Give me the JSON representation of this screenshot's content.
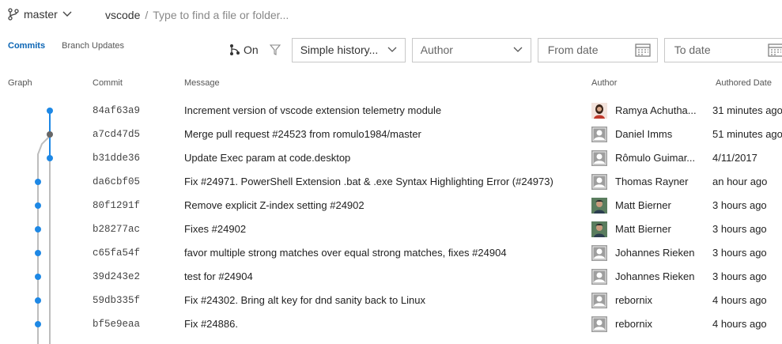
{
  "topbar": {
    "branch": "master",
    "repo": "vscode",
    "separator": "/",
    "search_placeholder": "Type to find a file or folder..."
  },
  "tabs": {
    "commits": "Commits",
    "branch_updates": "Branch Updates"
  },
  "filters": {
    "graph_toggle": "On",
    "history_mode": "Simple history...",
    "author": "Author",
    "from_date": "From date",
    "to_date": "To date"
  },
  "columns": {
    "graph": "Graph",
    "commit": "Commit",
    "message": "Message",
    "author": "Author",
    "authored_date": "Authored Date"
  },
  "commits": [
    {
      "sha": "84af63a9",
      "message": "Increment version of vscode extension telemetry module",
      "author": "Ramya Achutha...",
      "date": "31 minutes ago",
      "avatar": "photo-woman"
    },
    {
      "sha": "a7cd47d5",
      "message": "Merge pull request #24523 from romulo1984/master",
      "author": "Daniel Imms",
      "date": "51 minutes ago",
      "avatar": "default"
    },
    {
      "sha": "b31dde36",
      "message": "Update Exec param at code.desktop",
      "author": "Rômulo Guimar...",
      "date": "4/11/2017",
      "avatar": "default"
    },
    {
      "sha": "da6cbf05",
      "message": "Fix #24971. PowerShell Extension .bat & .exe Syntax Highlighting Error (#24973)",
      "author": "Thomas Rayner",
      "date": "an hour ago",
      "avatar": "default"
    },
    {
      "sha": "80f1291f",
      "message": "Remove explicit Z-index setting #24902",
      "author": "Matt Bierner",
      "date": "3 hours ago",
      "avatar": "photo-man"
    },
    {
      "sha": "b28277ac",
      "message": "Fixes #24902",
      "author": "Matt Bierner",
      "date": "3 hours ago",
      "avatar": "photo-man"
    },
    {
      "sha": "c65fa54f",
      "message": "favor multiple strong matches over equal strong matches, fixes #24904",
      "author": "Johannes Rieken",
      "date": "3 hours ago",
      "avatar": "default"
    },
    {
      "sha": "39d243e2",
      "message": "test for #24904",
      "author": "Johannes Rieken",
      "date": "3 hours ago",
      "avatar": "default"
    },
    {
      "sha": "59db335f",
      "message": "Fix #24302. Bring alt key for dnd sanity back to Linux",
      "author": "rebornix",
      "date": "4 hours ago",
      "avatar": "default"
    },
    {
      "sha": "bf5e9eaa",
      "message": "Fix #24886.",
      "author": "rebornix",
      "date": "4 hours ago",
      "avatar": "default"
    }
  ],
  "colors": {
    "accent": "#0a64b4",
    "graph_line": "#1e88e5",
    "merge_node": "#666666",
    "graph_branch": "#bdbdbd"
  }
}
